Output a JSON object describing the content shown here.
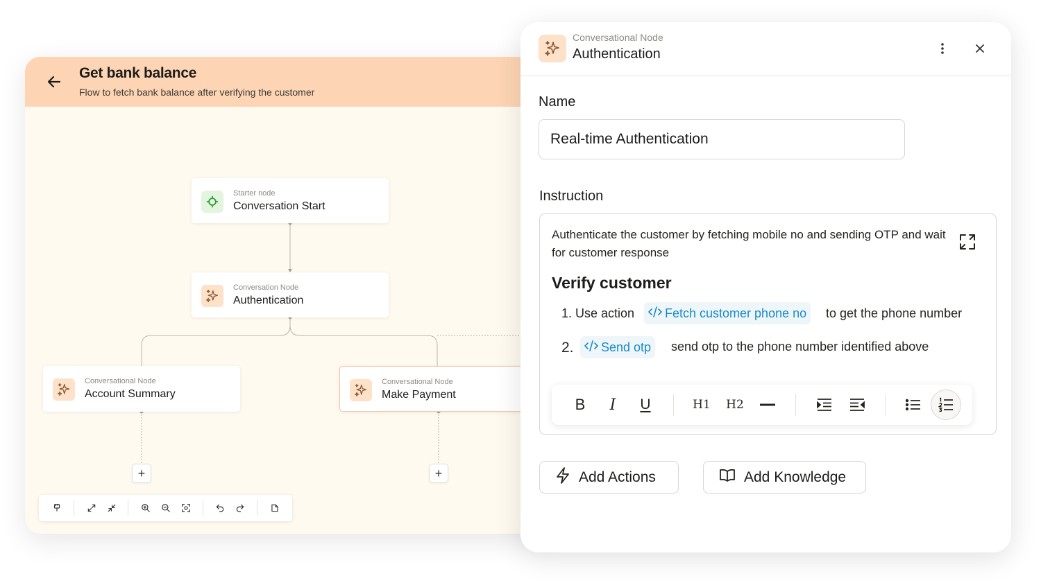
{
  "flow": {
    "title": "Get bank balance",
    "subtitle": "Flow to fetch bank balance after verifying the customer",
    "nodes": [
      {
        "kind": "Starter node",
        "name": "Conversation Start",
        "icon": "crosshair-icon"
      },
      {
        "kind": "Conversation Node",
        "name": "Authentication",
        "icon": "sparkle-icon"
      },
      {
        "kind": "Conversational Node",
        "name": "Account Summary",
        "icon": "sparkle-icon"
      },
      {
        "kind": "Conversational Node",
        "name": "Make Payment",
        "icon": "sparkle-icon"
      }
    ],
    "add_label": "+",
    "toolbar_icons": [
      "paint-icon",
      "expand-icon",
      "collapse-icon",
      "zoom-in-icon",
      "zoom-out-icon",
      "fit-view-icon",
      "undo-icon",
      "redo-icon",
      "export-icon"
    ]
  },
  "panel": {
    "node_kind": "Conversational Node",
    "node_name": "Authentication",
    "name_label": "Name",
    "name_value": "Real-time Authentication",
    "instruction_label": "Instruction",
    "instruction_text": "Authenticate the customer by fetching mobile no and sending OTP and wait for customer response",
    "heading": "Verify customer",
    "steps": [
      {
        "num": "1.",
        "prefix": "Use action",
        "action": "Fetch customer phone no",
        "suffix": "to get the phone number"
      },
      {
        "num": "2.",
        "prefix": "",
        "action": "Send otp",
        "suffix": "send otp to the phone number identified above"
      }
    ],
    "format": {
      "bold": "B",
      "italic": "I",
      "underline": "U",
      "h1": "H1",
      "h2": "H2"
    },
    "add_actions": "Add Actions",
    "add_knowledge": "Add Knowledge"
  },
  "colors": {
    "header_bg": "#fdd5b4",
    "canvas_bg": "#fffaf0",
    "accent_blue": "#1a8bc7",
    "node_icon_orange": "#fde1c9",
    "node_icon_green": "#e3f5df"
  }
}
